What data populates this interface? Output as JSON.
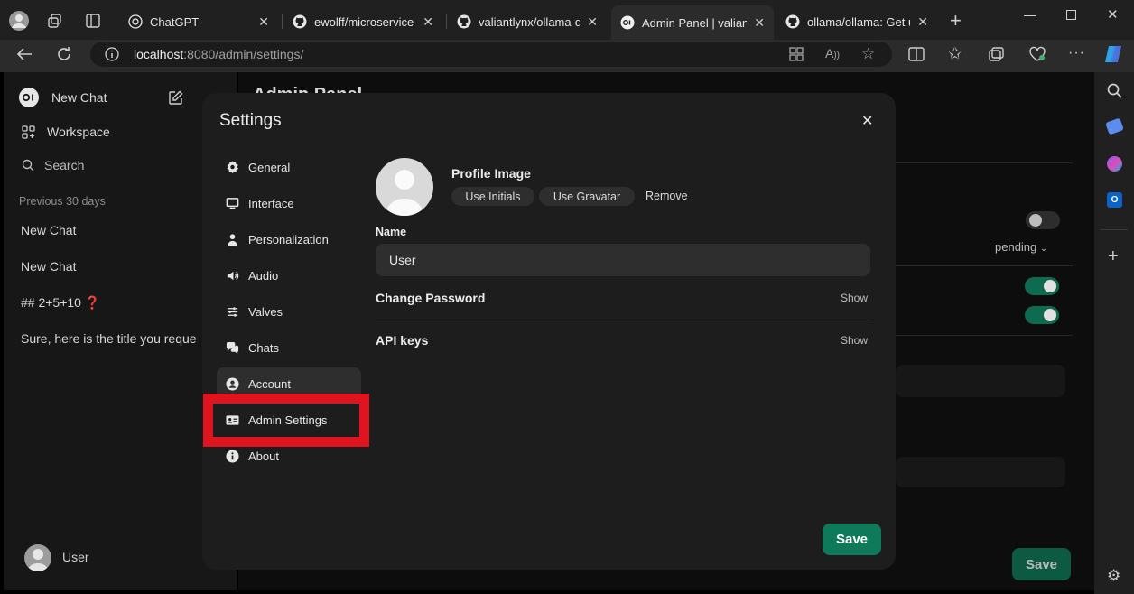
{
  "browser": {
    "tabs": [
      {
        "title": "ChatGPT",
        "icon": "chatgpt-icon"
      },
      {
        "title": "ewolff/microservice-ku",
        "icon": "github-icon"
      },
      {
        "title": "valiantlynx/ollama-doc",
        "icon": "github-icon"
      },
      {
        "title": "Admin Panel | valiantly",
        "icon": "openwebui-icon",
        "active": true
      },
      {
        "title": "ollama/ollama: Get up",
        "icon": "github-icon"
      }
    ],
    "url_host": "localhost",
    "url_path": ":8080/admin/settings/"
  },
  "sidebar": {
    "new_chat": "New Chat",
    "workspace": "Workspace",
    "search": "Search",
    "section_label": "Previous 30 days",
    "chats": [
      "New Chat",
      "New Chat",
      "## 2+5+10 ❓",
      "Sure, here is the title you reque"
    ],
    "user": "User"
  },
  "backdrop": {
    "title": "Admin Panel",
    "pending": "pending",
    "save": "Save"
  },
  "modal": {
    "title": "Settings",
    "nav": [
      {
        "label": "General",
        "icon": "gear-icon"
      },
      {
        "label": "Interface",
        "icon": "monitor-icon"
      },
      {
        "label": "Personalization",
        "icon": "person-icon"
      },
      {
        "label": "Audio",
        "icon": "speaker-icon"
      },
      {
        "label": "Valves",
        "icon": "sliders-icon"
      },
      {
        "label": "Chats",
        "icon": "chat-bubbles-icon"
      },
      {
        "label": "Account",
        "icon": "user-circle-icon",
        "active": true
      },
      {
        "label": "Admin Settings",
        "icon": "id-card-icon"
      },
      {
        "label": "About",
        "icon": "info-icon"
      }
    ],
    "profile_image_label": "Profile Image",
    "use_initials": "Use Initials",
    "use_gravatar": "Use Gravatar",
    "remove": "Remove",
    "name_label": "Name",
    "name_value": "User",
    "change_password": "Change Password",
    "change_password_action": "Show",
    "api_keys": "API keys",
    "api_keys_action": "Show",
    "save": "Save"
  },
  "colors": {
    "accent_green": "#0f7a5a",
    "highlight_red": "#e0141e",
    "toggle_on": "#0f6b4f"
  }
}
